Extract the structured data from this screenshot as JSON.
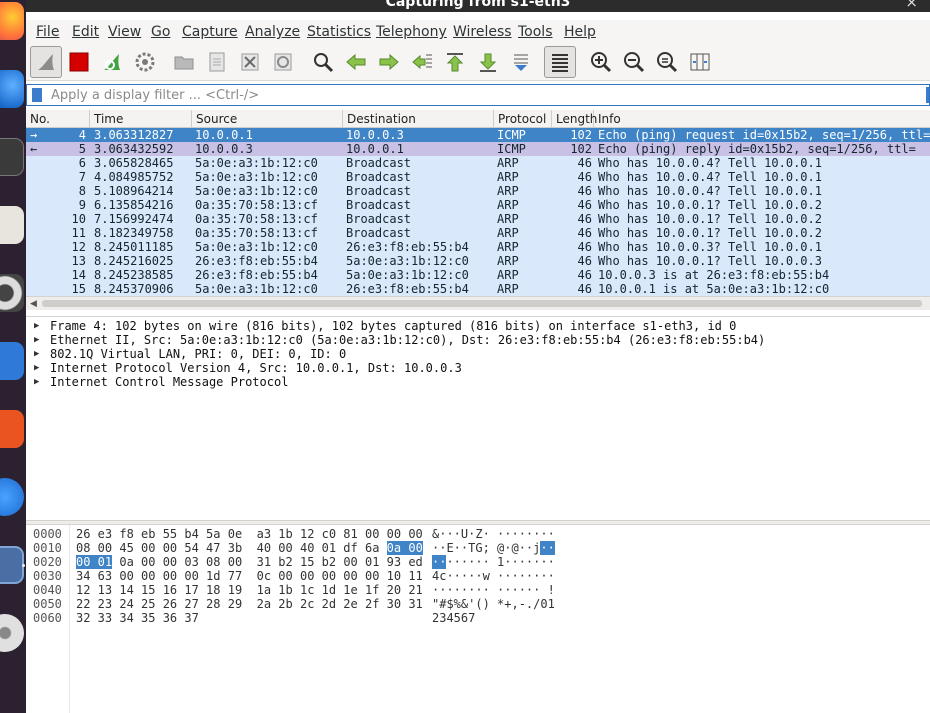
{
  "window": {
    "title": "Capturing from s1-eth3"
  },
  "menu": [
    "File",
    "Edit",
    "View",
    "Go",
    "Capture",
    "Analyze",
    "Statistics",
    "Telephony",
    "Wireless",
    "Tools",
    "Help"
  ],
  "filter": {
    "placeholder": "Apply a display filter ... <Ctrl-/>",
    "value": ""
  },
  "packet_list": {
    "columns": [
      "No.",
      "Time",
      "Source",
      "Destination",
      "Protocol",
      "Length",
      "Info"
    ],
    "rows": [
      {
        "no": "4",
        "time": "3.063312827",
        "src": "10.0.0.1",
        "dst": "10.0.0.3",
        "proto": "ICMP",
        "len": "102",
        "info": "Echo (ping) request  id=0x15b2, seq=1/256, ttl=",
        "marker": "→"
      },
      {
        "no": "5",
        "time": "3.063432592",
        "src": "10.0.0.3",
        "dst": "10.0.0.1",
        "proto": "ICMP",
        "len": "102",
        "info": "Echo (ping) reply    id=0x15b2, seq=1/256, ttl=",
        "marker": "←"
      },
      {
        "no": "6",
        "time": "3.065828465",
        "src": "5a:0e:a3:1b:12:c0",
        "dst": "Broadcast",
        "proto": "ARP",
        "len": "46",
        "info": "Who has 10.0.0.4? Tell 10.0.0.1",
        "marker": ""
      },
      {
        "no": "7",
        "time": "4.084985752",
        "src": "5a:0e:a3:1b:12:c0",
        "dst": "Broadcast",
        "proto": "ARP",
        "len": "46",
        "info": "Who has 10.0.0.4? Tell 10.0.0.1",
        "marker": ""
      },
      {
        "no": "8",
        "time": "5.108964214",
        "src": "5a:0e:a3:1b:12:c0",
        "dst": "Broadcast",
        "proto": "ARP",
        "len": "46",
        "info": "Who has 10.0.0.4? Tell 10.0.0.1",
        "marker": ""
      },
      {
        "no": "9",
        "time": "6.135854216",
        "src": "0a:35:70:58:13:cf",
        "dst": "Broadcast",
        "proto": "ARP",
        "len": "46",
        "info": "Who has 10.0.0.1? Tell 10.0.0.2",
        "marker": ""
      },
      {
        "no": "10",
        "time": "7.156992474",
        "src": "0a:35:70:58:13:cf",
        "dst": "Broadcast",
        "proto": "ARP",
        "len": "46",
        "info": "Who has 10.0.0.1? Tell 10.0.0.2",
        "marker": ""
      },
      {
        "no": "11",
        "time": "8.182349758",
        "src": "0a:35:70:58:13:cf",
        "dst": "Broadcast",
        "proto": "ARP",
        "len": "46",
        "info": "Who has 10.0.0.1? Tell 10.0.0.2",
        "marker": ""
      },
      {
        "no": "12",
        "time": "8.245011185",
        "src": "5a:0e:a3:1b:12:c0",
        "dst": "26:e3:f8:eb:55:b4",
        "proto": "ARP",
        "len": "46",
        "info": "Who has 10.0.0.3? Tell 10.0.0.1",
        "marker": ""
      },
      {
        "no": "13",
        "time": "8.245216025",
        "src": "26:e3:f8:eb:55:b4",
        "dst": "5a:0e:a3:1b:12:c0",
        "proto": "ARP",
        "len": "46",
        "info": "Who has 10.0.0.1? Tell 10.0.0.3",
        "marker": ""
      },
      {
        "no": "14",
        "time": "8.245238585",
        "src": "26:e3:f8:eb:55:b4",
        "dst": "5a:0e:a3:1b:12:c0",
        "proto": "ARP",
        "len": "46",
        "info": "10.0.0.3 is at 26:e3:f8:eb:55:b4",
        "marker": ""
      },
      {
        "no": "15",
        "time": "8.245370906",
        "src": "5a:0e:a3:1b:12:c0",
        "dst": "26:e3:f8:eb:55:b4",
        "proto": "ARP",
        "len": "46",
        "info": "10.0.0.1 is at 5a:0e:a3:1b:12:c0",
        "marker": ""
      }
    ]
  },
  "details": [
    "Frame 4: 102 bytes on wire (816 bits), 102 bytes captured (816 bits) on interface s1-eth3, id 0",
    "Ethernet II, Src: 5a:0e:a3:1b:12:c0 (5a:0e:a3:1b:12:c0), Dst: 26:e3:f8:eb:55:b4 (26:e3:f8:eb:55:b4)",
    "802.1Q Virtual LAN, PRI: 0, DEI: 0, ID: 0",
    "Internet Protocol Version 4, Src: 10.0.0.1, Dst: 10.0.0.3",
    "Internet Control Message Protocol"
  ],
  "bytes": [
    {
      "off": "0000",
      "hex": "26 e3 f8 eb 55 b4 5a 0e  a3 1b 12 c0 81 00 00 00",
      "ascii": "&···U·Z· ········"
    },
    {
      "off": "0010",
      "hex": "08 00 45 00 00 54 47 3b  40 00 40 01 df 6a ",
      "hex_hl": "0a 00",
      "ascii": "··E··TG; @·@··j",
      "ascii_hl": "··"
    },
    {
      "off": "0020",
      "hex_hl_lead": "00 01",
      "hex": " 0a 00 00 03 08 00  31 b2 15 b2 00 01 93 ed",
      "ascii_hl_lead": "··",
      "ascii": "······ 1·······"
    },
    {
      "off": "0030",
      "hex": "34 63 00 00 00 00 1d 77  0c 00 00 00 00 00 10 11",
      "ascii": "4c·····w ········"
    },
    {
      "off": "0040",
      "hex": "12 13 14 15 16 17 18 19  1a 1b 1c 1d 1e 1f 20 21",
      "ascii": "········ ······ !"
    },
    {
      "off": "0050",
      "hex": "22 23 24 25 26 27 28 29  2a 2b 2c 2d 2e 2f 30 31",
      "ascii": "\"#$%&'() *+,-./01"
    },
    {
      "off": "0060",
      "hex": "32 33 34 35 36 37",
      "ascii": "234567"
    }
  ],
  "colors": {
    "selected_row": "#3f84c6",
    "arp_row": "#dae8fc",
    "icmp_reply_row": "#c9c0e6",
    "filter_accent": "#3d7ccd"
  }
}
